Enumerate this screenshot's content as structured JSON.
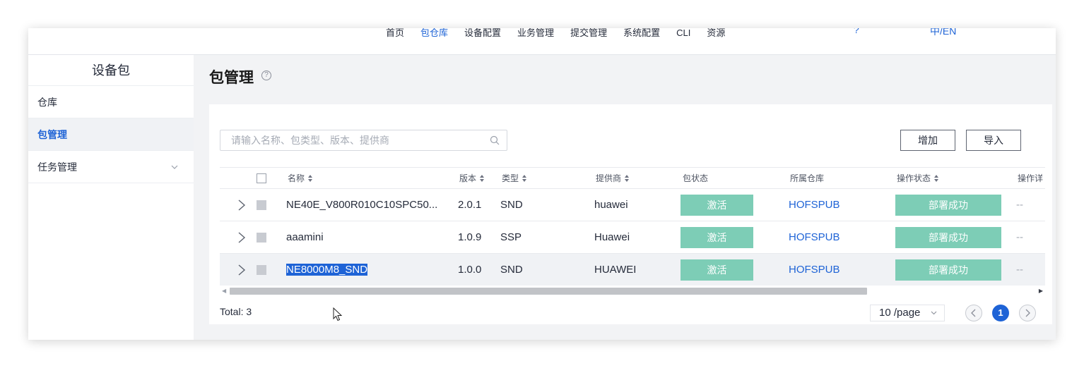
{
  "topnav": {
    "menu": [
      {
        "label": "首页",
        "active": false
      },
      {
        "label": "包仓库",
        "active": true
      },
      {
        "label": "设备配置",
        "active": false
      },
      {
        "label": "业务管理",
        "active": false
      },
      {
        "label": "提交管理",
        "active": false
      },
      {
        "label": "系统配置",
        "active": false
      },
      {
        "label": "CLI",
        "active": false
      },
      {
        "label": "资源",
        "active": false
      }
    ],
    "help": "?",
    "lang": "中/EN"
  },
  "sidebar": {
    "title": "设备包",
    "items": [
      {
        "label": "仓库"
      },
      {
        "label": "包管理"
      },
      {
        "label": "任务管理",
        "has_submenu": true
      }
    ]
  },
  "main": {
    "title": "包管理",
    "help_icon": "?",
    "search": {
      "placeholder": "请输入名称、包类型、版本、提供商",
      "value": ""
    },
    "add_label": "增加",
    "import_label": "导入",
    "table": {
      "headers": [
        "名称",
        "版本",
        "类型",
        "提供商",
        "包状态",
        "所属仓库",
        "操作状态",
        "操作详"
      ],
      "rows": [
        {
          "name": "NE40E_V800R010C10SPC50...",
          "version": "2.0.1",
          "type": "SND",
          "vendor": "huawei",
          "status": "激活",
          "repo": "HOFSPUB",
          "op_status": "部署成功",
          "op_detail": "--"
        },
        {
          "name": "aaamini",
          "version": "1.0.9",
          "type": "SSP",
          "vendor": "Huawei",
          "status": "激活",
          "repo": "HOFSPUB",
          "op_status": "部署成功",
          "op_detail": "--"
        },
        {
          "name": "NE8000M8_SND",
          "version": "1.0.0",
          "type": "SND",
          "vendor": "HUAWEI",
          "status": "激活",
          "repo": "HOFSPUB",
          "op_status": "部署成功",
          "op_detail": "--"
        }
      ]
    },
    "total_label": "Total: 3",
    "page_size": "10 /page",
    "current_page": "1"
  },
  "colors": {
    "accent": "#1e63d6",
    "status_tag": "#7dcdb6",
    "selected_row": "#f0f2f5"
  }
}
